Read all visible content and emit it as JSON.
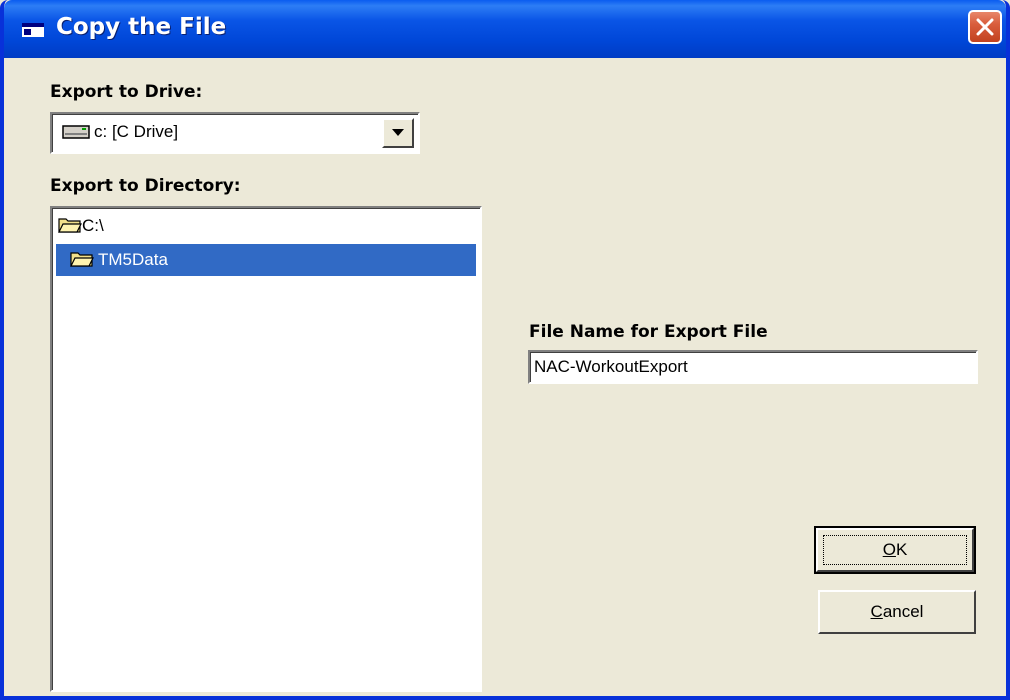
{
  "window": {
    "title": "Copy the File",
    "title_icon": "window-icon",
    "close_icon": "close-icon"
  },
  "drive": {
    "label": "Export to Drive:",
    "selected": "c: [C Drive]",
    "icon": "drive-icon"
  },
  "directory": {
    "label": "Export to Directory:",
    "items": [
      {
        "name": "C:\\",
        "icon": "open-folder-icon",
        "selected": false
      },
      {
        "name": "TM5Data",
        "icon": "open-folder-icon",
        "selected": true
      }
    ]
  },
  "filename": {
    "label": "File Name for Export File",
    "value": "NAC-WorkoutExport"
  },
  "buttons": {
    "ok_mnemonic": "O",
    "ok_rest": "K",
    "cancel_mnemonic": "C",
    "cancel_rest": "ancel"
  },
  "colors": {
    "titlebar": "#0a55e6",
    "selection": "#316ac5",
    "dialog_bg": "#ece9d8",
    "close": "#d95e3d"
  }
}
